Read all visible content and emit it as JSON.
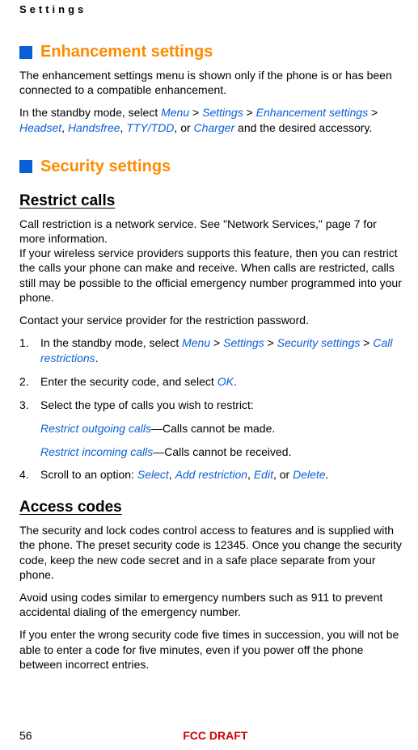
{
  "header": {
    "label": "Settings"
  },
  "section1": {
    "heading": "Enhancement settings",
    "para1": "The enhancement settings menu is shown only if the phone is or has been connected to a compatible enhancement.",
    "para2_a": "In the standby mode, select ",
    "menu": "Menu",
    "gt": " > ",
    "settings": "Settings",
    "enh": "Enhancement settings",
    "headset": "Headset",
    "hf": "Handsfree",
    "tty": "TTY/TDD",
    "charger": "Charger",
    "para2_tail": " and the desired accessory."
  },
  "section2": {
    "heading": "Security settings",
    "sub1": "Restrict calls",
    "p1": "Call restriction is a network service. See \"Network Services,\" page 7 for more information.",
    "p1b": "If your wireless service providers supports this feature, then you can restrict the calls your phone can make and receive. When calls are restricted, calls still may be possible to the official emergency number programmed into your phone.",
    "p2": "Contact your service provider for the restriction password.",
    "step1_a": "In the standby mode, select ",
    "menu": "Menu",
    "gt": " > ",
    "settings": "Settings",
    "sec": "Security settings",
    "callr": "Call restrictions",
    "step2_a": "Enter the security code, and select ",
    "ok": "OK",
    "step3": "Select the type of calls you wish to restrict:",
    "rout": "Restrict outgoing calls",
    "rout_tail": "—Calls cannot be made.",
    "rin": "Restrict incoming calls",
    "rin_tail": "—Calls cannot be received.",
    "step4_a": "Scroll to an option: ",
    "sel": "Select",
    "add": "Add restriction",
    "edit": "Edit",
    "del": "Delete",
    "sub2": "Access codes",
    "ac_p1": "The security and lock codes control access to features and is supplied with the phone. The preset security code is 12345. Once you change the security code, keep the new code secret and in a safe place separate from your phone.",
    "ac_p2": "Avoid using codes similar to emergency numbers such as 911 to prevent accidental dialing of the emergency number.",
    "ac_p3": "If you enter the wrong security code five times in succession, you will not be able to enter a code for five minutes, even if you power off the phone between incorrect entries."
  },
  "footer": {
    "page": "56",
    "draft": "FCC DRAFT"
  },
  "punct": {
    "comma_sp": ", ",
    "period": ".",
    "or_sp": ", or "
  }
}
